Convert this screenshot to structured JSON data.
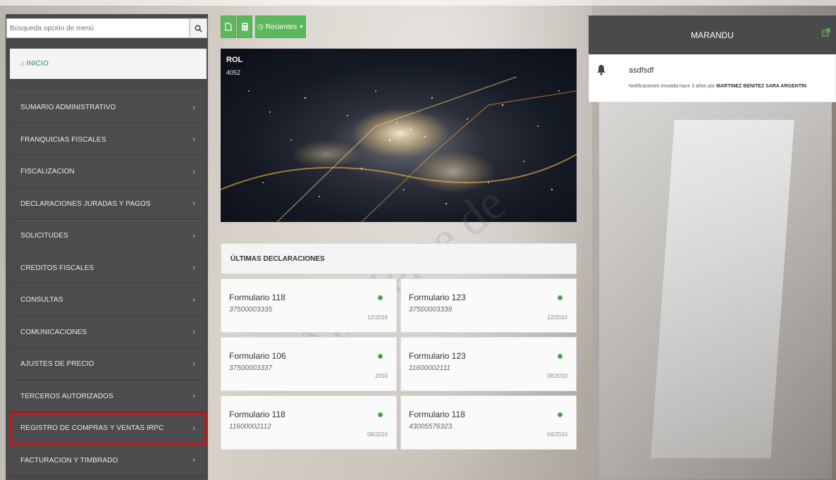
{
  "search": {
    "placeholder": "Búsqueda opción de menú"
  },
  "sidebar": {
    "home_label": "INICIO",
    "items": [
      {
        "label": "SUMARIO ADMINISTRATIVO"
      },
      {
        "label": "FRANQUICIAS FISCALES"
      },
      {
        "label": "FISCALIZACION"
      },
      {
        "label": "DECLARACIONES JURADAS Y PAGOS"
      },
      {
        "label": "SOLICITUDES"
      },
      {
        "label": "CREDITOS FISCALES"
      },
      {
        "label": "CONSULTAS"
      },
      {
        "label": "COMUNICACIONES"
      },
      {
        "label": "AJUSTES DE PRECIO"
      },
      {
        "label": "TERCEROS AUTORIZADOS"
      },
      {
        "label": "REGISTRO DE COMPRAS Y VENTAS IRPC",
        "highlighted": true
      },
      {
        "label": "FACTURACION Y TIMBRADO"
      }
    ]
  },
  "toolbar": {
    "recent_label": "Recientes"
  },
  "hero": {
    "title": "ROL",
    "subtitle": "4052"
  },
  "declarations": {
    "header": "ÚLTIMAS DECLARACIONES",
    "cards": [
      {
        "title": "Formulario 118",
        "number": "37500003335",
        "date": "12/2016"
      },
      {
        "title": "Formulario 123",
        "number": "37500003339",
        "date": "12/2010"
      },
      {
        "title": "Formulario 106",
        "number": "37500003337",
        "date": "2010"
      },
      {
        "title": "Formulario 123",
        "number": "11600002111",
        "date": "08/2010"
      },
      {
        "title": "Formulario 118",
        "number": "11600002112",
        "date": "08/2010"
      },
      {
        "title": "Formulario 118",
        "number": "43005576323",
        "date": "04/2010"
      }
    ]
  },
  "watermark": {
    "text": "Ambiente de"
  },
  "notifications": {
    "title": "MARANDU",
    "item": {
      "title": "asdfsdf",
      "text_prefix": "Notificaciones enviada hace 3 años por",
      "author": "MARTINEZ BENITEZ SARA ARGENTIN"
    }
  },
  "colors": {
    "accent_green": "#5cb85c",
    "sidebar_bg": "#4a4a4a",
    "highlight_red": "#d0121b"
  }
}
